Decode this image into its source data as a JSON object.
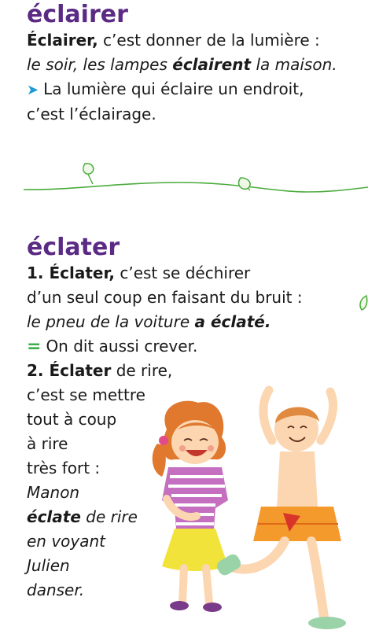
{
  "entry1": {
    "headword": "éclairer",
    "definition_term": "Éclairer,",
    "definition_rest": " c’est donner de la lumière :",
    "example_before": "le soir, les lampes ",
    "example_bold": "éclairent",
    "example_after": " la maison.",
    "derived_line1": "La lumière qui éclaire un endroit,",
    "derived_line2": "c’est l’éclairage."
  },
  "entry2": {
    "headword": "éclater",
    "sense1_number_term": "1. Éclater,",
    "sense1_rest": " c’est se déchirer",
    "sense1_line2": "d’un seul coup en faisant du bruit :",
    "sense1_example_before": "le pneu de la voiture ",
    "sense1_example_bold": "a éclaté.",
    "synonym_text": "On dit aussi crever.",
    "sense2_number_term": "2. Éclater",
    "sense2_rest": " de rire,",
    "sense2_lines": [
      "c’est se mettre",
      "tout à coup",
      "à rire",
      "très fort :"
    ],
    "sense2_example_line1": "Manon",
    "sense2_example_bold": "éclate",
    "sense2_example_line2_rest": " de rire",
    "sense2_example_lines": [
      "en voyant",
      "Julien",
      "danser."
    ]
  },
  "icons": {
    "arrow": "arrow-right-icon",
    "synonym": "equals-icon",
    "vine": "leaf-vine-divider",
    "illustration": "children-laughing-dancing-illustration"
  },
  "colors": {
    "headword": "#5b2a84",
    "arrow": "#1c9ad6",
    "synonym": "#3bb04a",
    "vine": "#4aab3c"
  }
}
